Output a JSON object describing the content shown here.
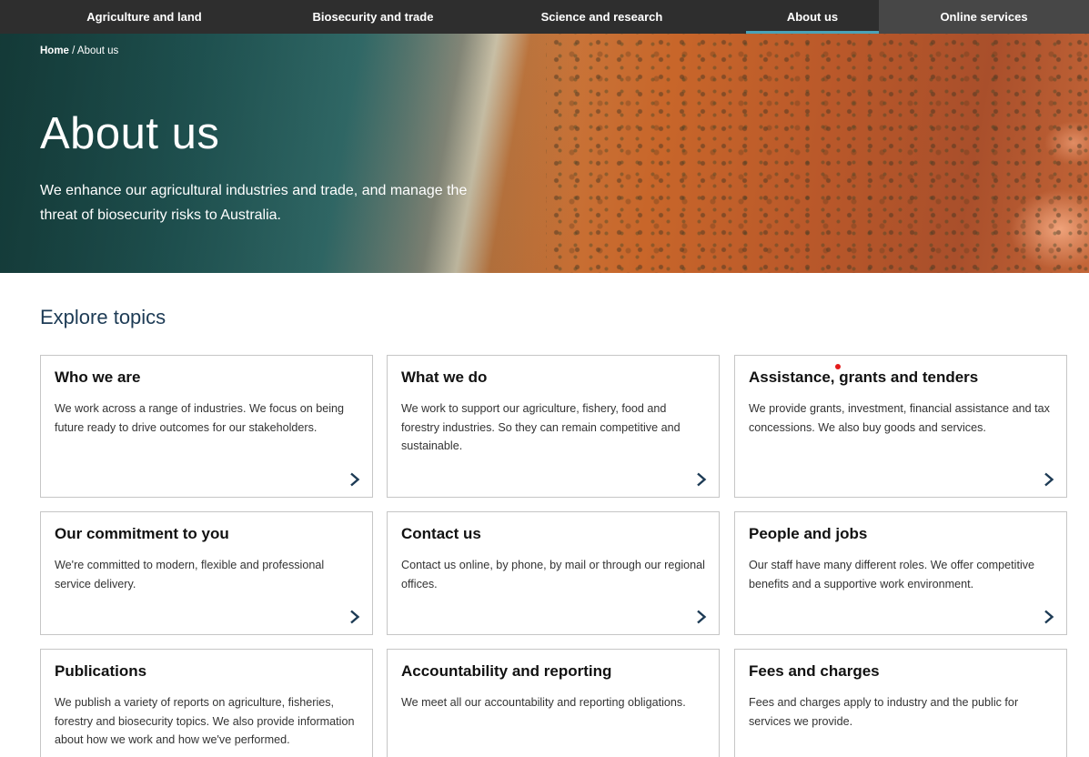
{
  "nav": {
    "items": [
      {
        "label": "Agriculture and land"
      },
      {
        "label": "Biosecurity and trade"
      },
      {
        "label": "Science and research"
      },
      {
        "label": "About us"
      },
      {
        "label": "Online services"
      }
    ],
    "active": "About us"
  },
  "colors": {
    "accent": "#4aa3b8",
    "nav_bg": "#2e2e2e",
    "heading": "#1d3b55"
  },
  "breadcrumb": {
    "home": "Home",
    "separator": " / ",
    "current": "About us"
  },
  "hero": {
    "title": "About us",
    "description": "We enhance our agricultural industries and trade, and manage the threat of biosecurity risks to Australia."
  },
  "explore": {
    "title": "Explore topics",
    "cards": [
      {
        "title": "Who we are",
        "text": "We work across a range of industries. We focus on being future ready to drive outcomes for our stakeholders."
      },
      {
        "title": "What we do",
        "text": "We work to support our agriculture, fishery, food and forestry industries. So they can remain competitive and sustainable."
      },
      {
        "title": "Assistance, grants and tenders",
        "text": "We provide grants, investment, financial assistance and tax concessions. We also buy goods and services."
      },
      {
        "title": "Our commitment to you",
        "text": "We're committed to modern, flexible and professional service delivery."
      },
      {
        "title": "Contact us",
        "text": "Contact us online, by phone, by mail or through our regional offices."
      },
      {
        "title": "People and jobs",
        "text": "Our staff have many different roles. We offer competitive benefits and a supportive work environment."
      },
      {
        "title": "Publications",
        "text": "We publish a variety of reports on agriculture, fisheries, forestry and biosecurity topics. We also provide information about how we work and how we've performed."
      },
      {
        "title": "Accountability and reporting",
        "text": "We meet all our accountability and reporting obligations."
      },
      {
        "title": "Fees and charges",
        "text": "Fees and charges apply to industry and the public for services we provide."
      }
    ]
  },
  "icons": {
    "card_arrow": "chevron-right-icon"
  }
}
